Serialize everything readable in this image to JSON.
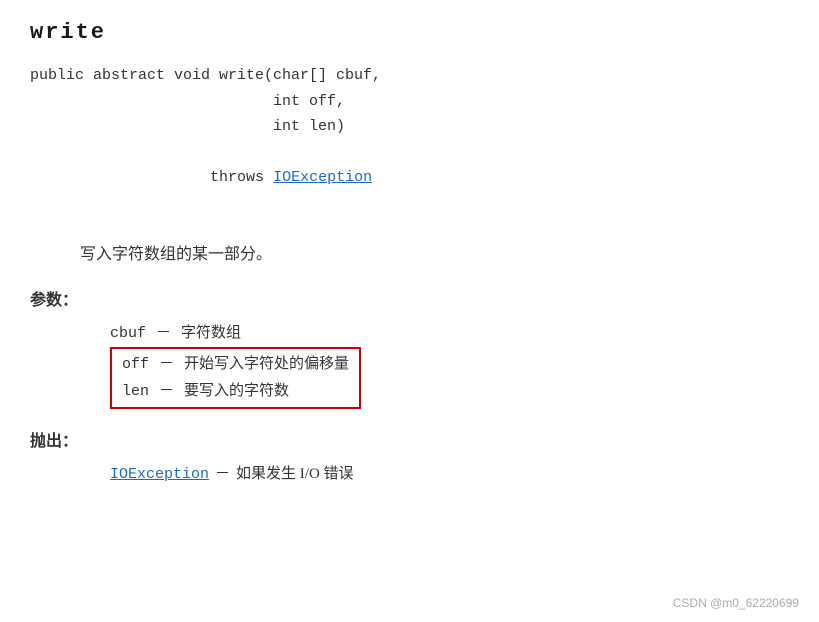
{
  "title": "write",
  "signature": {
    "line1": "public abstract void write(char[] cbuf,",
    "line2": "                           int off,",
    "line3": "                           int len)",
    "line4": "                throws ",
    "throws_link": "IOException"
  },
  "description": "写入字符数组的某一部分。",
  "params_label": "参数：",
  "params": [
    {
      "name": "cbuf",
      "dash": "－",
      "desc": "字符数组",
      "highlighted": false
    },
    {
      "name": "off",
      "dash": "－",
      "desc": "开始写入字符处的偏移量",
      "highlighted": true
    },
    {
      "name": "len",
      "dash": "－",
      "desc": "要写入的字符数",
      "highlighted": true
    }
  ],
  "throws_label": "抛出：",
  "throws": [
    {
      "name": "IOException",
      "dash": "－",
      "desc": "如果发生 I/O 错误"
    }
  ],
  "watermark": "CSDN @m0_62220699"
}
